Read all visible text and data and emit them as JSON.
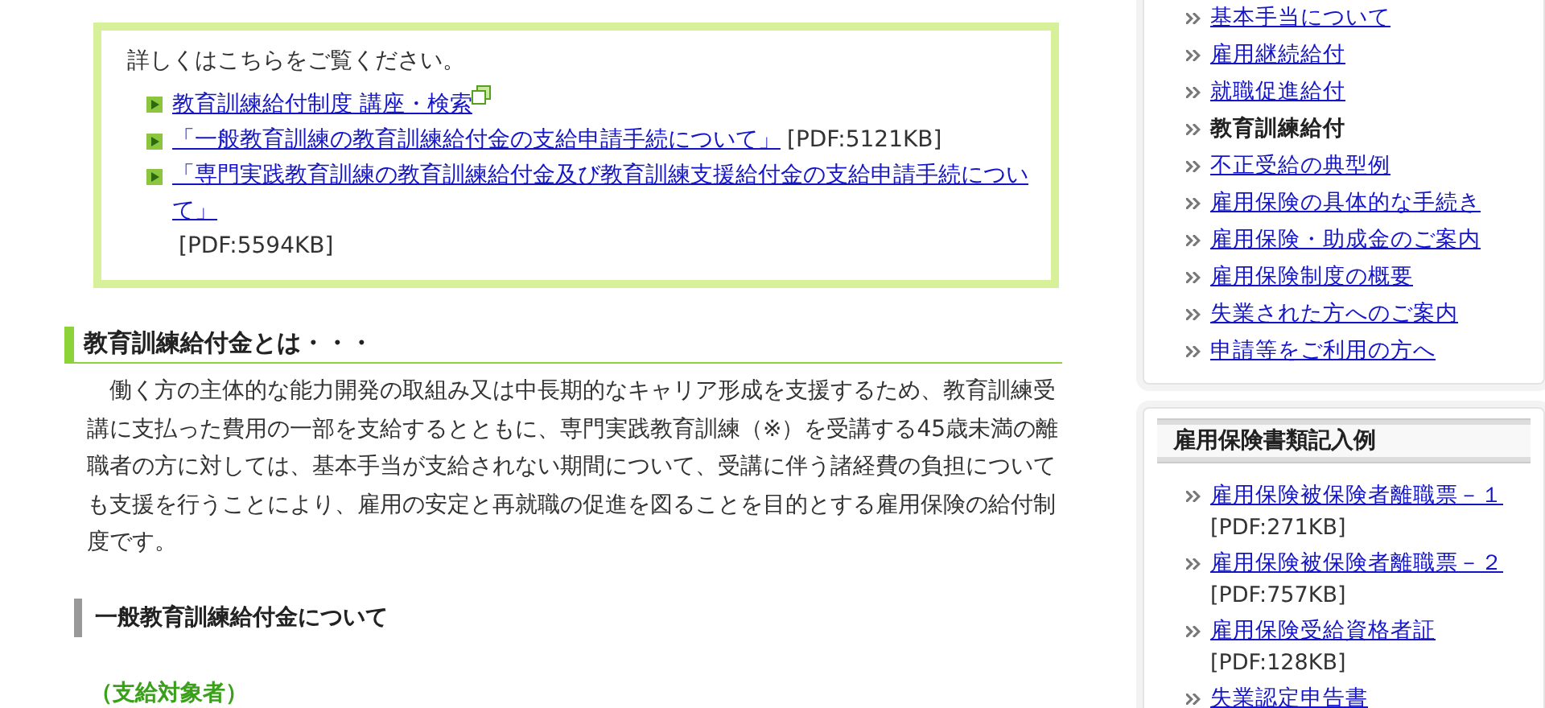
{
  "info_box": {
    "intro": "詳しくはこちらをご覧ください。",
    "links": [
      {
        "text": "教育訓練給付制度 講座・検索",
        "external": true
      },
      {
        "text": "「一般教育訓練の教育訓練給付金の支給申請手続について」",
        "external": false,
        "size": "[PDF:5121KB]"
      },
      {
        "text": "「専門実践教育訓練の教育訓練給付金及び教育訓練支援給付金の支給申請手続について」",
        "external": false,
        "size": "[PDF:5594KB]"
      }
    ]
  },
  "section": {
    "heading": "教育訓練給付金とは・・・",
    "body": "　働く方の主体的な能力開発の取組み又は中長期的なキャリア形成を支援するため、教育訓練受講に支払った費用の一部を支給するとともに、専門実践教育訓練（※）を受講する45歳未満の離職者の方に対しては、基本手当が支給されない期間について、受講に伴う諸経費の負担についても支援を行うことにより、雇用の安定と再就職の促進を図ることを目的とする雇用保険の給付制度です。"
  },
  "subsection": {
    "heading": "一般教育訓練給付金について",
    "label": "（支給対象者）"
  },
  "sidebar": {
    "nav": [
      {
        "text": "基本手当について",
        "selected": false
      },
      {
        "text": "雇用継続給付",
        "selected": false
      },
      {
        "text": "就職促進給付",
        "selected": false
      },
      {
        "text": "教育訓練給付",
        "selected": true
      },
      {
        "text": "不正受給の典型例",
        "selected": false
      },
      {
        "text": "雇用保険の具体的な手続き",
        "selected": false
      },
      {
        "text": "雇用保険・助成金のご案内",
        "selected": false
      },
      {
        "text": "雇用保険制度の概要",
        "selected": false
      },
      {
        "text": "失業された方へのご案内",
        "selected": false
      },
      {
        "text": "申請等をご利用の方へ",
        "selected": false
      }
    ],
    "forms_panel": {
      "title": "雇用保険書類記入例",
      "items": [
        {
          "text": "雇用保険被保険者離職票－１",
          "size": "[PDF:271KB]"
        },
        {
          "text": "雇用保険被保険者離職票－２",
          "size": "[PDF:757KB]"
        },
        {
          "text": "雇用保険受給資格者証",
          "size": "[PDF:128KB]"
        },
        {
          "text": "失業認定申告書"
        }
      ]
    }
  }
}
